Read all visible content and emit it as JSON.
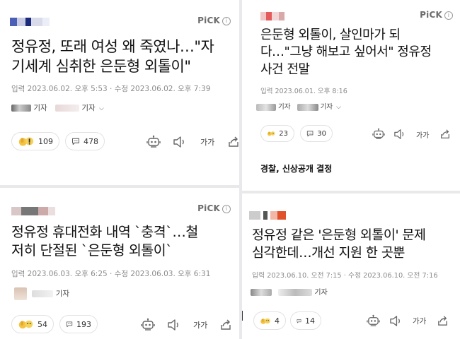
{
  "cards": [
    {
      "pick": "PiCK",
      "headline_lines": [
        "정유정, 또래 여성 왜 죽였나…\"자",
        "기세계 심취한 은둔형 외톨이\""
      ],
      "meta": "입력 2023.06.02. 오후 5:53 · 수정 2023.06.02. 오후 7:39",
      "reporter_label": "기자",
      "reporter_label_2": "기자",
      "reaction_count": "109",
      "comment_count": "478",
      "font_size_label": "가가"
    },
    {
      "pick": "PiCK",
      "headline_lines": [
        "은둔형 외톨이, 살인마가 되",
        "다…\"그냥 해보고 싶어서\" 정유정",
        "사건 전말"
      ],
      "meta": "입력 2023.06.01. 오후 8:16",
      "reporter_label": "기자",
      "reporter_label_2": "기자",
      "reaction_count": "23",
      "comment_count": "30",
      "font_size_label": "가가",
      "subhead": "경찰, 신상공개 결정"
    },
    {
      "pick": "PiCK",
      "headline_lines": [
        "정유정 휴대전화 내역 `충격`…철",
        "저히 단절된 `은둔형 외톨이`"
      ],
      "meta": "입력 2023.06.03. 오후 6:25 · 수정 2023.06.03. 오후 6:31",
      "reporter_label": "기자",
      "reaction_count": "54",
      "comment_count": "193",
      "font_size_label": "가가"
    },
    {
      "headline_lines": [
        "정유정 같은 '은둔형 외톨이' 문제",
        "심각한데…개선 지원 한 곳뿐"
      ],
      "meta": "입력 2023.06.10. 오전 7:15 · 수정 2023.06.10. 오전 7:16",
      "reporter_label": "기자",
      "reaction_count": "4",
      "comment_count": "14",
      "font_size_label": "가가"
    }
  ],
  "colors": {
    "divider": "#e9e9ec",
    "pick_text": "#6c6c6c",
    "meta_text": "#8a8a8a",
    "thumb_yellow": "#f5c342",
    "icon_gray": "#666666"
  },
  "icons": [
    "robot-summary-icon",
    "speaker-icon",
    "share-icon",
    "comment-icon",
    "reaction-emoji-icon",
    "info-icon",
    "chevron-down-icon"
  ]
}
